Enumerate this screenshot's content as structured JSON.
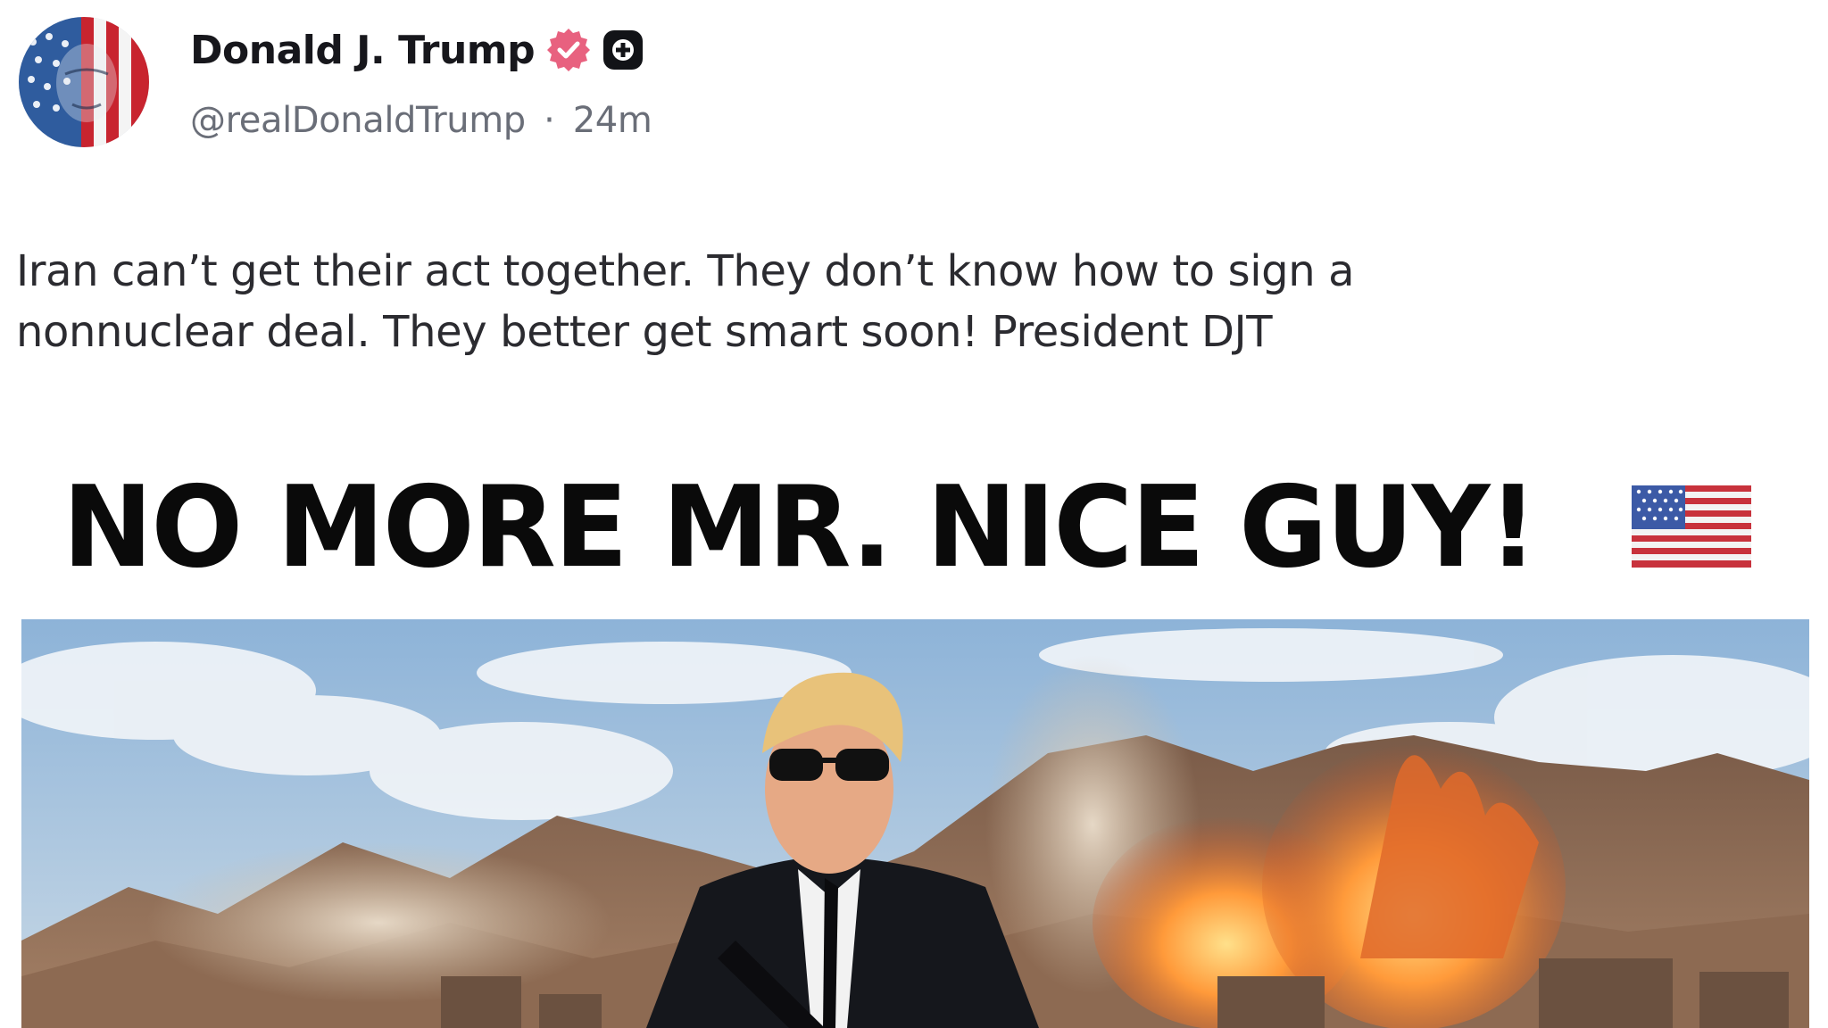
{
  "post": {
    "author": {
      "display_name": "Donald J. Trump",
      "handle": "@realDonaldTrump",
      "separator": "·",
      "time_ago": "24m"
    },
    "text": "Iran can’t get their act together. They don’t know how to sign a\nnonnuclear deal. They better get smart soon! President DJT",
    "media": {
      "headline": "NO MORE MR. NICE GUY!"
    }
  },
  "icons": {
    "verified": "verified-badge-icon",
    "plus": "plus-badge-icon",
    "flag": "us-flag-icon"
  },
  "colors": {
    "verified_badge": "#e8617f",
    "handle_gray": "#6a6e78",
    "headline_black": "#0a0a0a"
  }
}
